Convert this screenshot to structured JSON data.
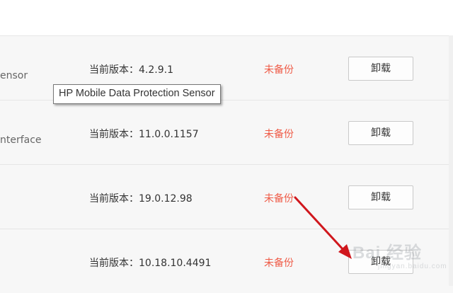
{
  "rows": [
    {
      "name": "ensor",
      "version": "当前版本：4.2.9.1",
      "status": "未备份",
      "uninstall_label": "卸载"
    },
    {
      "name": "nterface",
      "version": "当前版本：11.0.0.1157",
      "status": "未备份",
      "uninstall_label": "卸载"
    },
    {
      "name": "",
      "version": "当前版本：19.0.12.98",
      "status": "未备份",
      "uninstall_label": "卸载"
    },
    {
      "name": "",
      "version": "当前版本：10.18.10.4491",
      "status": "未备份",
      "uninstall_label": "卸载"
    }
  ],
  "tooltip": {
    "text": "HP Mobile Data Protection Sensor"
  },
  "watermark": {
    "text": "Bai 经验",
    "sub": "jingyan.baidu.com"
  },
  "colors": {
    "status": "#ef5b47",
    "arrow": "#d0171d",
    "row_background": "#f7f7f7"
  }
}
